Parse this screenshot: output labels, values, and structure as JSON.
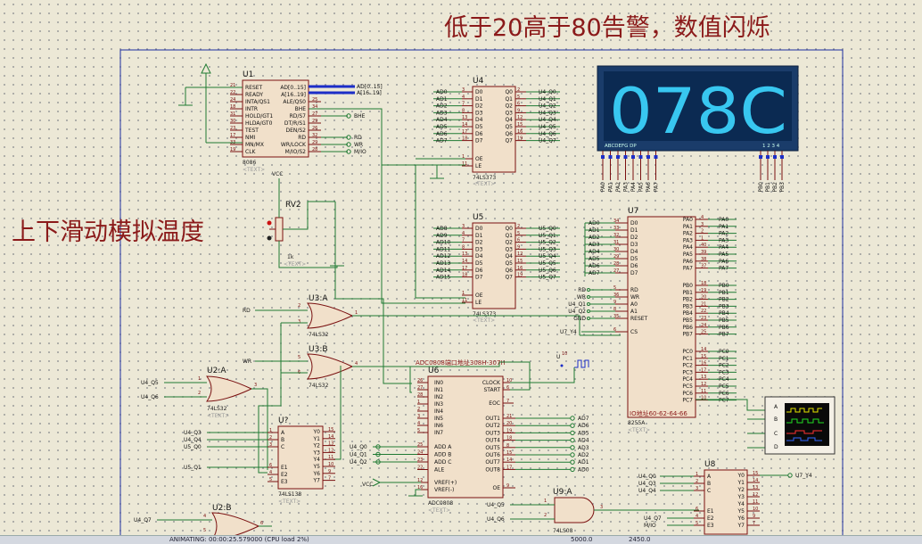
{
  "header": {
    "title": "低于20高于80告警，数值闪烁",
    "slide_note": "上下滑动模拟温度"
  },
  "display": {
    "digits": "078C",
    "seg_labels": "ABCDEFG  DP",
    "digit_labels": "1 2 3 4",
    "seg_pins": [
      "PA0",
      "PA1",
      "PA2",
      "PA3",
      "PA4",
      "PA5",
      "PA6",
      "PA7"
    ],
    "digit_pins": [
      "PB0",
      "PB1",
      "PB2",
      "PB3"
    ]
  },
  "u1": {
    "ref": "U1",
    "part": "8086",
    "tmp": "<TEXT>",
    "left_pins": [
      "RESET",
      "READY",
      "INTA/QS1",
      "INTR",
      "HOLD/GT1",
      "HLDA/GT0",
      "TEST",
      "NMI",
      "MN/MX",
      "CLK"
    ],
    "left_nums": [
      "21",
      "22",
      "24",
      "18",
      "31",
      "30",
      "23",
      "17",
      "33",
      "19"
    ],
    "right_pins": [
      "AD[0..15]",
      "A[16..19]",
      "ALE/QS0",
      "BHE",
      "RD/S7",
      "DT/R/S1",
      "DEN/S2",
      "RD",
      "WR/LOCK",
      "M/IO/S2"
    ],
    "right_nums": [
      "",
      "",
      "25",
      "34",
      "27",
      "29",
      "26",
      "32",
      "29",
      "28"
    ],
    "bus_labels": [
      "AD[0..15]",
      "A[16..19]"
    ],
    "net_labels": [
      "BHE",
      "RD",
      "WR",
      "M/IO"
    ]
  },
  "u4": {
    "ref": "U4",
    "part": "74LS373",
    "tmp": "<TEXT>",
    "inputs": [
      "AD0",
      "AD1",
      "AD2",
      "AD3",
      "AD4",
      "AD5",
      "AD6",
      "AD7"
    ],
    "in_nums": [
      "3",
      "4",
      "7",
      "8",
      "13",
      "14",
      "17",
      "18"
    ],
    "in_pins": [
      "D0",
      "D1",
      "D2",
      "D3",
      "D4",
      "D5",
      "D6",
      "D7"
    ],
    "out_pins": [
      "Q0",
      "Q1",
      "Q2",
      "Q3",
      "Q4",
      "Q5",
      "Q6",
      "Q7"
    ],
    "out_nums": [
      "2",
      "5",
      "6",
      "9",
      "12",
      "15",
      "16",
      "19"
    ],
    "outputs": [
      "U4_Q0",
      "U4_Q1",
      "U4_Q2",
      "U4_Q3",
      "U4_Q4",
      "U4_Q5",
      "U4_Q6",
      "U4_Q7"
    ],
    "ctrl": [
      "OE",
      "LE"
    ],
    "ctrl_nums": [
      "1",
      "11"
    ]
  },
  "u5": {
    "ref": "U5",
    "part": "74LS373",
    "tmp": "<TEXT>",
    "inputs": [
      "AD8",
      "AD9",
      "AD10",
      "AD11",
      "AD12",
      "AD13",
      "AD14",
      "AD15"
    ],
    "in_nums": [
      "3",
      "4",
      "7",
      "8",
      "13",
      "14",
      "17",
      "18"
    ],
    "in_pins": [
      "D0",
      "D1",
      "D2",
      "D3",
      "D4",
      "D5",
      "D6",
      "D7"
    ],
    "out_pins": [
      "Q0",
      "Q1",
      "Q2",
      "Q3",
      "Q4",
      "Q5",
      "Q6",
      "Q7"
    ],
    "out_nums": [
      "2",
      "5",
      "6",
      "9",
      "12",
      "15",
      "16",
      "19"
    ],
    "outputs": [
      "U5_Q0",
      "U5_Q1",
      "U5_Q2",
      "U5_Q3",
      "U5_Q4",
      "U5_Q5",
      "U5_Q6",
      "U5_Q7"
    ],
    "ctrl": [
      "OE",
      "LE"
    ],
    "ctrl_nums": [
      "1",
      "11"
    ]
  },
  "u7": {
    "ref": "U7",
    "part": "8255A",
    "tmp": "<TEXT>",
    "caption": "IO地址60-62-64-66",
    "d_inputs": [
      "AD0",
      "AD1",
      "AD2",
      "AD3",
      "AD4",
      "AD5",
      "AD6",
      "AD7"
    ],
    "d_nums": [
      "34",
      "33",
      "32",
      "31",
      "30",
      "29",
      "28",
      "27"
    ],
    "d_pins": [
      "D0",
      "D1",
      "D2",
      "D3",
      "D4",
      "D5",
      "D6",
      "D7"
    ],
    "ctrl_inputs": [
      "RD",
      "WR",
      "U4_Q1",
      "U4_Q2",
      "GND"
    ],
    "ctrl_nums": [
      "5",
      "36",
      "9",
      "8",
      "35"
    ],
    "ctrl_pins": [
      "RD",
      "WR",
      "A0",
      "A1",
      "RESET"
    ],
    "cs_input": "U7_Y4",
    "cs_num": "6",
    "cs_pin": "CS",
    "pa_pins": [
      "PA0",
      "PA1",
      "PA2",
      "PA3",
      "PA4",
      "PA5",
      "PA6",
      "PA7"
    ],
    "pa_nums": [
      "4",
      "3",
      "2",
      "1",
      "40",
      "39",
      "38",
      "37"
    ],
    "pb_pins": [
      "PB0",
      "PB1",
      "PB2",
      "PB3",
      "PB4",
      "PB5",
      "PB6",
      "PB7"
    ],
    "pb_nums": [
      "18",
      "19",
      "20",
      "21",
      "22",
      "23",
      "24",
      "25"
    ],
    "pc_pins": [
      "PC0",
      "PC1",
      "PC2",
      "PC3",
      "PC4",
      "PC5",
      "PC6",
      "PC7"
    ],
    "pc_nums": [
      "14",
      "15",
      "16",
      "17",
      "13",
      "12",
      "11",
      "10"
    ]
  },
  "u6": {
    "ref": "U6",
    "part": "ADC0808",
    "tmp": "<TEXT>",
    "caption": "ADC0808端口地址308H-307H",
    "left_pins": [
      "IN0",
      "IN1",
      "IN2",
      "IN3",
      "IN4",
      "IN5",
      "IN6",
      "IN7"
    ],
    "left_nums": [
      "26",
      "27",
      "28",
      "1",
      "2",
      "3",
      "4",
      "5"
    ],
    "addr_pins": [
      "ADD A",
      "ADD B",
      "ADD C",
      "ALE"
    ],
    "addr_nums": [
      "25",
      "24",
      "23",
      "22"
    ],
    "addr_inputs": [
      "U4_Q0",
      "U4_Q1",
      "U4_Q2"
    ],
    "ref_pins": [
      "VREF(+)",
      "VREF(-)"
    ],
    "ref_nums": [
      "12",
      "16"
    ],
    "right_top": [
      "CLOCK",
      "START",
      "EOC"
    ],
    "right_top_nums": [
      "10",
      "6",
      "7"
    ],
    "out_pins": [
      "OUT1",
      "OUT2",
      "OUT3",
      "OUT4",
      "OUT5",
      "OUT6",
      "OUT7",
      "OUT8"
    ],
    "out_nums": [
      "21",
      "20",
      "19",
      "18",
      "8",
      "15",
      "14",
      "17"
    ],
    "outputs": [
      "AD7",
      "AD6",
      "AD5",
      "AD4",
      "AD3",
      "AD2",
      "AD1",
      "AD0"
    ],
    "oe": "OE",
    "oe_num": "9",
    "clk_num": "10"
  },
  "u3a": {
    "ref": "U3:A",
    "part": "74LS32",
    "in_net": "RD",
    "in_nums": [
      "2",
      "3"
    ],
    "out_num": "1"
  },
  "u3b": {
    "ref": "U3:B",
    "part": "74LS32",
    "in_net": "WR",
    "in_nums": [
      "5",
      "6"
    ],
    "out_num": "4"
  },
  "u2a": {
    "ref": "U2:A",
    "part": "74LS32",
    "tmp": "<TEXT>",
    "inputs": [
      "U4_Q5",
      "U4_Q6"
    ],
    "in_nums": [
      "1",
      "2"
    ],
    "out_num": "3"
  },
  "u2b": {
    "ref": "U2:B",
    "in_nums": [
      "4",
      "5"
    ],
    "out_num": "6",
    "input": "U4_Q7"
  },
  "uq": {
    "ref": "U?",
    "part": "74LS138",
    "tmp": "<TEXT>",
    "inputs": [
      "U4_Q3",
      "U4_Q4",
      "U5_Q0"
    ],
    "in_nums": [
      "1",
      "2",
      "3"
    ],
    "in_pins": [
      "A",
      "B",
      "C"
    ],
    "e_input": "U5_Q1",
    "e_pins": [
      "E1",
      "E2",
      "E3"
    ],
    "e_nums": [
      "6",
      "4",
      "5"
    ],
    "out_pins": [
      "Y0",
      "Y1",
      "Y2",
      "Y3",
      "Y4",
      "Y5",
      "Y6",
      "Y7"
    ],
    "out_nums": [
      "15",
      "14",
      "13",
      "12",
      "11",
      "10",
      "9",
      "7"
    ]
  },
  "u8": {
    "ref": "U8",
    "inputs": [
      "U4_Q0",
      "U4_Q3",
      "U4_Q4"
    ],
    "in_nums": [
      "1",
      "2",
      "3"
    ],
    "in_pins": [
      "A",
      "B",
      "C"
    ],
    "e_inputs": [
      "U4_Q7",
      "M/IO"
    ],
    "e_pins": [
      "E1",
      "E2",
      "E3"
    ],
    "e_nums": [
      "6",
      "4",
      "5"
    ],
    "out_pins": [
      "Y0",
      "Y1",
      "Y2",
      "Y3",
      "Y4",
      "Y5",
      "Y6",
      "Y7"
    ],
    "out_nums": [
      "15",
      "14",
      "13",
      "12",
      "11",
      "10",
      "9",
      "7"
    ],
    "output": "U7_Y4"
  },
  "u9a": {
    "ref": "U9:A",
    "part": "74LS08",
    "inputs": [
      "U4_Q5",
      "U4_Q6"
    ],
    "in_nums": [
      "1",
      "2"
    ],
    "out_num": "3"
  },
  "rv2": {
    "ref": "RV2",
    "tmp": "<TEXT>",
    "pct": "1k",
    "vcc": "VCC"
  },
  "scope": {
    "channels": [
      "A",
      "B",
      "C",
      "D"
    ]
  },
  "vref_label": "VCC",
  "clock_ref": "U",
  "taskbar": {
    "items": [
      "ANIMATING: 00:00:25.579000 (CPU load 2%)",
      "5000.0",
      "2450.0"
    ]
  }
}
